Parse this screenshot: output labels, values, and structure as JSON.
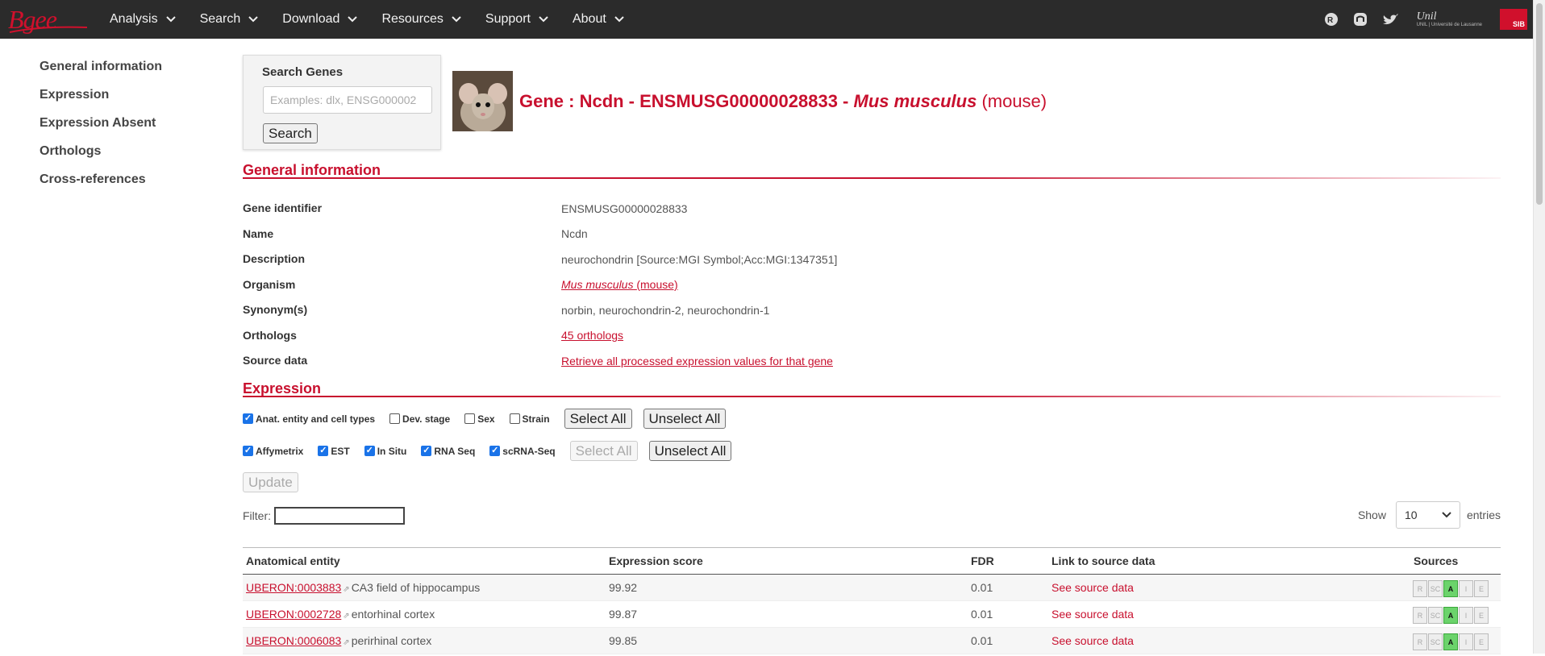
{
  "nav": {
    "logo": "Bgee",
    "items": [
      "Analysis",
      "Search",
      "Download",
      "Resources",
      "Support",
      "About"
    ],
    "unil": "Unil",
    "unil_sub": "UNIL | Université de Lausanne",
    "sib": "SIB"
  },
  "leftnav": [
    "General information",
    "Expression",
    "Expression Absent",
    "Orthologs",
    "Cross-references"
  ],
  "search": {
    "title": "Search Genes",
    "placeholder": "Examples: dlx, ENSG000002",
    "button": "Search"
  },
  "gene": {
    "prefix": "Gene : Ncdn - ENSMUSG00000028833 - ",
    "species": "Mus musculus",
    "common": "(mouse)"
  },
  "general": {
    "heading": "General information",
    "rows": [
      {
        "label": "Gene identifier",
        "value": "ENSMUSG00000028833"
      },
      {
        "label": "Name",
        "value": "Ncdn"
      },
      {
        "label": "Description",
        "value": "neurochondrin [Source:MGI Symbol;Acc:MGI:1347351]"
      },
      {
        "label": "Organism",
        "species": "Mus musculus",
        "common": "(mouse)"
      },
      {
        "label": "Synonym(s)",
        "value": "norbin, neurochondrin-2, neurochondrin-1"
      },
      {
        "label": "Orthologs",
        "link": "45 orthologs"
      },
      {
        "label": "Source data",
        "link": "Retrieve all processed expression values for that gene"
      }
    ]
  },
  "expression": {
    "heading": "Expression",
    "filters1": [
      {
        "label": "Anat. entity and cell types",
        "checked": true
      },
      {
        "label": "Dev. stage",
        "checked": false
      },
      {
        "label": "Sex",
        "checked": false
      },
      {
        "label": "Strain",
        "checked": false
      }
    ],
    "filters2": [
      {
        "label": "Affymetrix",
        "checked": true
      },
      {
        "label": "EST",
        "checked": true
      },
      {
        "label": "In Situ",
        "checked": true
      },
      {
        "label": "RNA Seq",
        "checked": true
      },
      {
        "label": "scRNA-Seq",
        "checked": true
      }
    ],
    "select_all": "Select All",
    "unselect_all": "Unselect All",
    "update": "Update",
    "filter_label": "Filter:",
    "show_label": "Show",
    "show_value": "10",
    "entries_label": "entries"
  },
  "table": {
    "headers": [
      "Anatomical entity",
      "Expression score",
      "FDR",
      "Link to source data",
      "Sources"
    ],
    "rows": [
      {
        "id": "UBERON:0003883",
        "name": "CA3 field of hippocampus",
        "score": "99.92",
        "fdr": "0.01",
        "link": "See source data"
      },
      {
        "id": "UBERON:0002728",
        "name": "entorhinal cortex",
        "score": "99.87",
        "fdr": "0.01",
        "link": "See source data"
      },
      {
        "id": "UBERON:0006083",
        "name": "perirhinal cortex",
        "score": "99.85",
        "fdr": "0.01",
        "link": "See source data"
      }
    ],
    "source_codes": [
      "R",
      "SC",
      "A",
      "I",
      "E"
    ],
    "active_source": "A"
  },
  "colors": {
    "brand_red": "#c8102e",
    "navbar": "#2b2b2b",
    "source_active": "#6bd36b"
  }
}
